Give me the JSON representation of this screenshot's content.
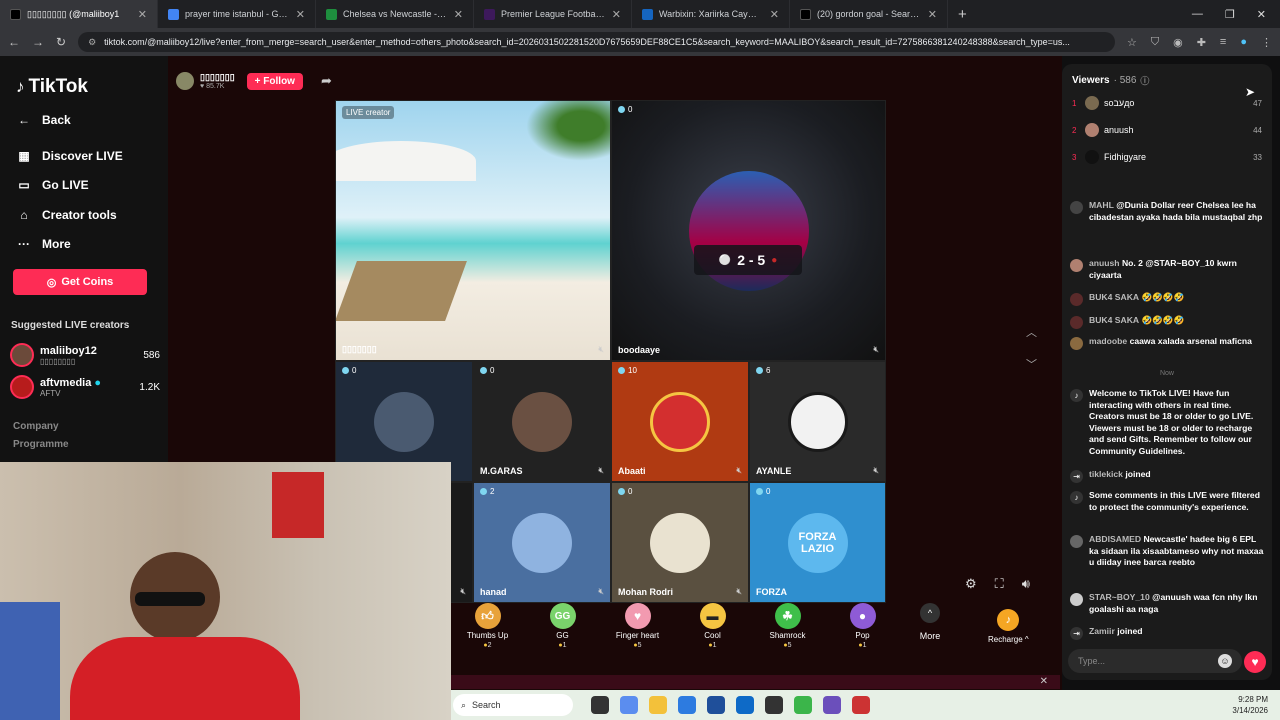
{
  "browser": {
    "tabs": [
      {
        "title": "▯▯▯▯▯▯▯▯ (@maliiboy1",
        "color": "#000000"
      },
      {
        "title": "prayer time istanbul - Google S",
        "color": "#4285f4"
      },
      {
        "title": "Chelsea vs Newcastle - live sco",
        "color": "#1e8e3e"
      },
      {
        "title": "Premier League Football News,",
        "color": "#3d195b"
      },
      {
        "title": "Warbixin: Xariirka Caymiska ee",
        "color": "#1565c0"
      },
      {
        "title": "(20) gordon goal - Search / X",
        "color": "#000000"
      }
    ],
    "url": "tiktok.com/@maliiboy12/live?enter_from_merge=search_user&enter_method=others_photo&search_id=2026031502281520D7675659DEF88CE1C5&search_keyword=MAALIBOY&search_result_id=7275866381240248388&search_type=us..."
  },
  "sidebar": {
    "brand": "TikTok",
    "back": "Back",
    "nav": [
      "Discover LIVE",
      "Go LIVE",
      "Creator tools",
      "More"
    ],
    "coins_button": "Get Coins",
    "suggested_title": "Suggested LIVE creators",
    "creators": [
      {
        "name": "maliiboy12",
        "sub": "▯▯▯▯▯▯▯▯",
        "count": "586"
      },
      {
        "name": "aftvmedia",
        "sub": "AFTV",
        "count": "1.2K"
      }
    ],
    "footer": [
      "Company",
      "Programme"
    ]
  },
  "stream": {
    "host_name": "▯▯▯▯▯▯▯",
    "host_likes": "85.7K",
    "follow": "+ Follow",
    "live_creator_badge": "LIVE creator",
    "main_guest": {
      "name": "boodaaye",
      "count": "0",
      "score": "2 - 5"
    },
    "host_tile_name": "▯▯▯▯▯▯▯",
    "guests": [
      {
        "name": "",
        "count": "0"
      },
      {
        "name": "M.GARAS",
        "count": "0"
      },
      {
        "name": "Abaati",
        "count": "10"
      },
      {
        "name": "AYANLE",
        "count": "6"
      },
      {
        "name": "hanad",
        "count": "2"
      },
      {
        "name": "Mohan Rodri",
        "count": "0"
      },
      {
        "name": "FORZA",
        "count": "0",
        "label": "FORZA LAZIO"
      }
    ]
  },
  "gifts": [
    {
      "name": "Thumbs Up",
      "price": "2",
      "icon": "thumbs-up-icon",
      "color": "#e8a23a"
    },
    {
      "name": "GG",
      "price": "1",
      "icon": "gg-icon",
      "color": "#7ad36b"
    },
    {
      "name": "Finger heart",
      "price": "5",
      "icon": "finger-heart-icon",
      "color": "#f29ab0"
    },
    {
      "name": "Cool",
      "price": "1",
      "icon": "sunglasses-icon",
      "color": "#f5c542"
    },
    {
      "name": "Shamrock",
      "price": "5",
      "icon": "shamrock-icon",
      "color": "#3fbf4a"
    },
    {
      "name": "Pop",
      "price": "1",
      "icon": "pop-icon",
      "color": "#8e5bd6"
    }
  ],
  "more_label": "More",
  "recharge_label": "Recharge",
  "viewers": {
    "title": "Viewers",
    "count": "586",
    "top": [
      {
        "rank": "1",
        "name": "ѕoעבдо",
        "score": "47"
      },
      {
        "rank": "2",
        "name": "anuush",
        "score": "44"
      },
      {
        "rank": "3",
        "name": "Fidhigyare",
        "score": "33"
      }
    ]
  },
  "chat": [
    {
      "user": "MAHL",
      "text": "@Dunia Dollar reer Chelsea lee ha cibadestan ayaka hada bila mustaqbal zhp"
    },
    {
      "user": "anuush",
      "text": "No. 2 @STAR~BOY_10 kwrn ciyaarta"
    },
    {
      "user": "BUK4 SAKA",
      "text": "🤣🤣🤣🤣"
    },
    {
      "user": "BUK4 SAKA",
      "text": "🤣🤣🤣🤣"
    },
    {
      "user": "madoobe",
      "text": "caawa xalada arsenal maficna"
    }
  ],
  "chat_now": "Now",
  "chat_after": [
    {
      "kind": "system",
      "text": "Welcome to TikTok LIVE! Have fun interacting with others in real time. Creators must be 18 or older to go LIVE. Viewers must be 18 or older to recharge and send Gifts. Remember to follow our Community Guidelines."
    },
    {
      "kind": "join",
      "user": "tiklekick",
      "text": "joined"
    },
    {
      "kind": "system",
      "text": "Some comments in this LIVE were filtered to protect the community's experience."
    },
    {
      "kind": "msg",
      "user": "ABDISAMED",
      "text": "Newcastle' hadee big 6 EPL ka sidaan ila xisaabtameso why not maxaa u diiday inee barca reebto"
    },
    {
      "kind": "msg",
      "user": "STAR~BOY_10",
      "text": "@anuush waa fcn nhy lkn goalashi aa naga"
    },
    {
      "kind": "join",
      "user": "Zamiir",
      "text": "joined"
    }
  ],
  "chat_input_placeholder": "Type...",
  "taskbar": {
    "search": "Search",
    "time": "9:28 PM",
    "date": "3/14/2026"
  }
}
